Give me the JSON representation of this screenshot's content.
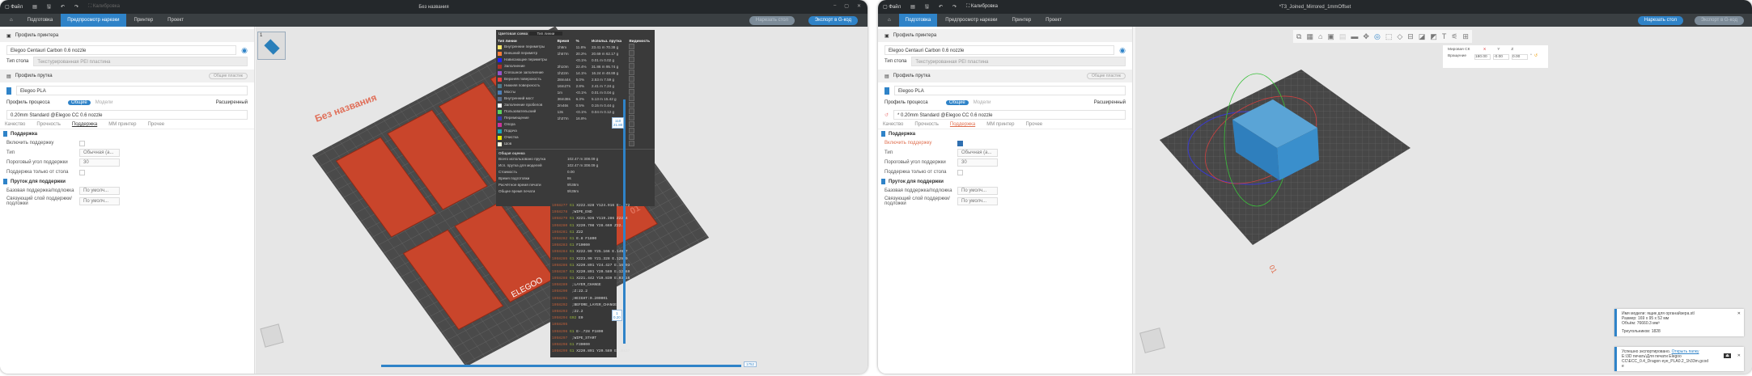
{
  "left": {
    "title": "Без названия",
    "menu": {
      "file": "Файл",
      "calibration": "Калибровка"
    },
    "tabs": [
      "Подготовка",
      "Предпросмотр нарезки",
      "Принтер",
      "Проект"
    ],
    "slice_button": "Нарезать стол",
    "export_button": "Экспорт в G-код",
    "printer_profile": "Профиль принтера",
    "printer": "Elegoo Centauri Carbon 0.6 nozzle",
    "bed_label": "Тип стола",
    "bed": "Текстурированная PEI пластина",
    "filament_profile": "Профиль прутка",
    "sync_button": "Общие пластик",
    "filament": "Elegoo PLA",
    "process_profile": "Профиль процесса",
    "toggle_global": "Общие",
    "toggle_object": "Модели",
    "advanced": "Расширенный",
    "process": "0.20mm Standard @Elegoo CC 0.6 nozzle",
    "subtabs": [
      "Качество",
      "Прочность",
      "Поддержка",
      "MM принтер",
      "Прочее"
    ],
    "group1": "Поддержка",
    "opts": [
      {
        "l": "Включить поддержку",
        "v": ""
      },
      {
        "l": "Тип",
        "v": "Обычная (а..."
      },
      {
        "l": "Пороговый угол поддержки",
        "v": "30"
      },
      {
        "l": "Поддержка только от стола",
        "v": ""
      }
    ],
    "group2": "Пруток для поддержки",
    "opts2": [
      {
        "l": "Базовая поддержка/подложка",
        "v": "По умолч..."
      },
      {
        "l": "Связующий слой поддержки/подложки",
        "v": "По умолч..."
      }
    ],
    "plate_name": "Без названия",
    "plate_num": "01",
    "bed_brand": "ELEGOO",
    "plate_thumb": "1",
    "layer_top": "110",
    "height_top": "21.80",
    "layer_bottom": "1",
    "height_bottom": "0.20",
    "move_value": "1752",
    "legend": {
      "scheme_label": "Цветовая схема",
      "scheme": "Тип линии",
      "headers": [
        "Тип линии",
        "Время",
        "%",
        "Использ. прутка",
        "Видимость"
      ],
      "rows": [
        {
          "n": "Внутренние периметры",
          "t": "1h9m",
          "p": "11.8%",
          "m": "23.41 m",
          "g": "70.38 g",
          "c": "#ffe66b"
        },
        {
          "n": "Внешний периметр",
          "t": "1h57m",
          "p": "20.2%",
          "m": "20.69 m",
          "g": "62.17 g",
          "c": "#ff7d38"
        },
        {
          "n": "Нависающие периметры",
          "t": "",
          "p": "<0.1%",
          "m": "0.01 m",
          "g": "0.02 g",
          "c": "#1f1fff"
        },
        {
          "n": "Заполнение",
          "t": "2h10m",
          "p": "22.4%",
          "m": "31.86 m",
          "g": "95.74 g",
          "c": "#b03029"
        },
        {
          "n": "Сплошное заполнение",
          "t": "1h22m",
          "p": "14.1%",
          "m": "16.24 m",
          "g": "48.88 g",
          "c": "#9654cc"
        },
        {
          "n": "Верхняя поверхность",
          "t": "28m44s",
          "p": "5.0%",
          "m": "2.53 m",
          "g": "7.59 g",
          "c": "#f04040"
        },
        {
          "n": "Нижняя поверхность",
          "t": "16m27s",
          "p": "2.8%",
          "m": "2.41 m",
          "g": "7.24 g",
          "c": "#4d7a8c"
        },
        {
          "n": "Мосты",
          "t": "1m",
          "p": "<0.1%",
          "m": "0.01 m",
          "g": "0.04 g",
          "c": "#4d80ba"
        },
        {
          "n": "Внутренний мост",
          "t": "36m38s",
          "p": "6.3%",
          "m": "5.13 m",
          "g": "15.42 g",
          "c": "#5c6f8c"
        },
        {
          "n": "Заполнение пробелов",
          "t": "2m46s",
          "p": "0.5%",
          "m": "0.15 m",
          "g": "0.44 g",
          "c": "#ffffff"
        },
        {
          "n": "Пользовательский",
          "t": "13s",
          "p": "<0.1%",
          "m": "0.04 m",
          "g": "0.12 g",
          "c": "#5ed35e"
        },
        {
          "n": "Перемещение",
          "t": "1h37m",
          "p": "16.8%",
          "m": "",
          "g": "",
          "c": "#3b3bb0"
        },
        {
          "n": "Опора",
          "t": "",
          "p": "",
          "m": "",
          "g": "",
          "c": "#cc3399"
        },
        {
          "n": "Подача",
          "t": "",
          "p": "",
          "m": "",
          "g": "",
          "c": "#1ba3b5"
        },
        {
          "n": "Очистка",
          "t": "",
          "p": "",
          "m": "",
          "g": "",
          "c": "#e6e600"
        },
        {
          "n": "Шов",
          "t": "",
          "p": "",
          "m": "",
          "g": "",
          "c": "#ffffe0"
        }
      ],
      "summary_title": "Общая оценка",
      "summary": [
        {
          "k": "Всего использовано прутка",
          "v": "102.47 m    308.09 g"
        },
        {
          "k": "Исп. прутка для моделей",
          "v": "102.47 m    308.09 g"
        },
        {
          "k": "Стоимость",
          "v": "0.00"
        },
        {
          "k": "Время подготовки",
          "v": "8s"
        },
        {
          "k": "Расчётное время печати",
          "v": "9h38m"
        },
        {
          "k": "Общее время печати",
          "v": "9h39m"
        }
      ]
    },
    "gcode": [
      {
        "n": "1958277",
        "c": "G1",
        "a": "X222.828 Y124.916 E-.072"
      },
      {
        "n": "1958278",
        "c": "",
        "a": ";WIPE_END"
      },
      {
        "n": "1958279",
        "c": "G1",
        "a": "X221.926 Y119.286 Z22.4"
      },
      {
        "n": "1958280",
        "c": "G1",
        "a": "X220.708 Y28.669 Z22.4"
      },
      {
        "n": "1958281",
        "c": "G1",
        "a": "Z22"
      },
      {
        "n": "1958282",
        "c": "G1",
        "a": "E.8 F1800"
      },
      {
        "n": "1958283",
        "c": "G1",
        "a": "F10000"
      },
      {
        "n": "1958284",
        "c": "G1",
        "a": "X222.99 Y25.166 E.14937"
      },
      {
        "n": "1958285",
        "c": "G1",
        "a": "X223.99 Y21.328 E.12569"
      },
      {
        "n": "1958286",
        "c": "G1",
        "a": "X220.891 Y24.427 E.16103"
      },
      {
        "n": "1958287",
        "c": "G1",
        "a": "X220.891 Y20.589 E.12569"
      },
      {
        "n": "1958288",
        "c": "G1",
        "a": "X221.442 Y19.839 E.03416"
      },
      {
        "n": "1958289",
        "c": "",
        "a": ";LAYER_CHANGE"
      },
      {
        "n": "1958290",
        "c": "",
        "a": ";Z:22.2"
      },
      {
        "n": "1958291",
        "c": "",
        "a": ";HEIGHT:0.200001"
      },
      {
        "n": "1958292",
        "c": "",
        "a": ";BEFORE_LAYER_CHANGE"
      },
      {
        "n": "1958293",
        "c": "",
        "a": ";22.2"
      },
      {
        "n": "1958294",
        "c": "G92",
        "a": "E0"
      },
      {
        "n": "1958295",
        "c": "",
        "a": ""
      },
      {
        "n": "1958296",
        "c": "G1",
        "a": "E-.728 F1800"
      },
      {
        "n": "1958297",
        "c": "",
        "a": ";WIPE_START"
      },
      {
        "n": "1958298",
        "c": "G1",
        "a": "F30000"
      },
      {
        "n": "1958299",
        "c": "G1",
        "a": "X220.891 Y20.589 E-.0437"
      }
    ]
  },
  "right": {
    "title": "*T3_Joined_Mirrored_1mmOffset",
    "menu": {
      "file": "Файл",
      "calibration": "Калибровка"
    },
    "tabs": [
      "Подготовка",
      "Предпросмотр нарезки",
      "Принтер",
      "Проект"
    ],
    "slice_button": "Нарезать стол",
    "export_button": "Экспорт в G-код",
    "printer_profile": "Профиль принтера",
    "printer": "Elegoo Centauri Carbon 0.6 nozzle",
    "bed_label": "Тип стола",
    "bed": "Текстурированная PEI пластина",
    "filament_profile": "Профиль прутка",
    "sync_button": "Общие пластик",
    "filament": "Elegoo PLA",
    "process_profile": "Профиль процесса",
    "toggle_global": "Общие",
    "toggle_object": "Модели",
    "advanced": "Расширенный",
    "process": "* 0.20mm Standard @Elegoo CC 0.6 nozzle",
    "subtabs": [
      "Качество",
      "Прочность",
      "Поддержка",
      "MM принтер",
      "Прочее"
    ],
    "group1": "Поддержка",
    "opts": [
      {
        "l": "Включить поддержку",
        "v": ""
      },
      {
        "l": "Тип",
        "v": "Обычная (а..."
      },
      {
        "l": "Пороговый угол поддержки",
        "v": "30"
      },
      {
        "l": "Поддержка только от стола",
        "v": ""
      }
    ],
    "group2": "Пруток для поддержки",
    "opts2": [
      {
        "l": "Базовая поддержка/подложка",
        "v": "По умолч..."
      },
      {
        "l": "Связующий слой поддержки/подложки",
        "v": "По умолч..."
      }
    ],
    "rotate": {
      "world_cs": "Мировая СК",
      "x": "X",
      "y": "Y",
      "z": "Z",
      "label": "Вращение",
      "vx": "180.00",
      "vy": "-0.00",
      "vz": "0.00",
      "unit": "°"
    },
    "plate_num": "01",
    "toasts": [
      {
        "l1": "Имя модели: ящик для органайзера.stl",
        "l2": "Размер: 169 x 95 x 52 мм",
        "l3": "Объём: 76660.3 мм³",
        "l4": "Треугольников: 1828"
      },
      {
        "l1": "Успешно экспортировано.",
        "link": "Открыть папку",
        "l2": "E:\\3D печать\\Для печати Elegoo",
        "l3": "CC\\ECC_0.4_Dragon eye_PLA0.2_1h33m.gcod",
        "l4": "e"
      }
    ]
  }
}
